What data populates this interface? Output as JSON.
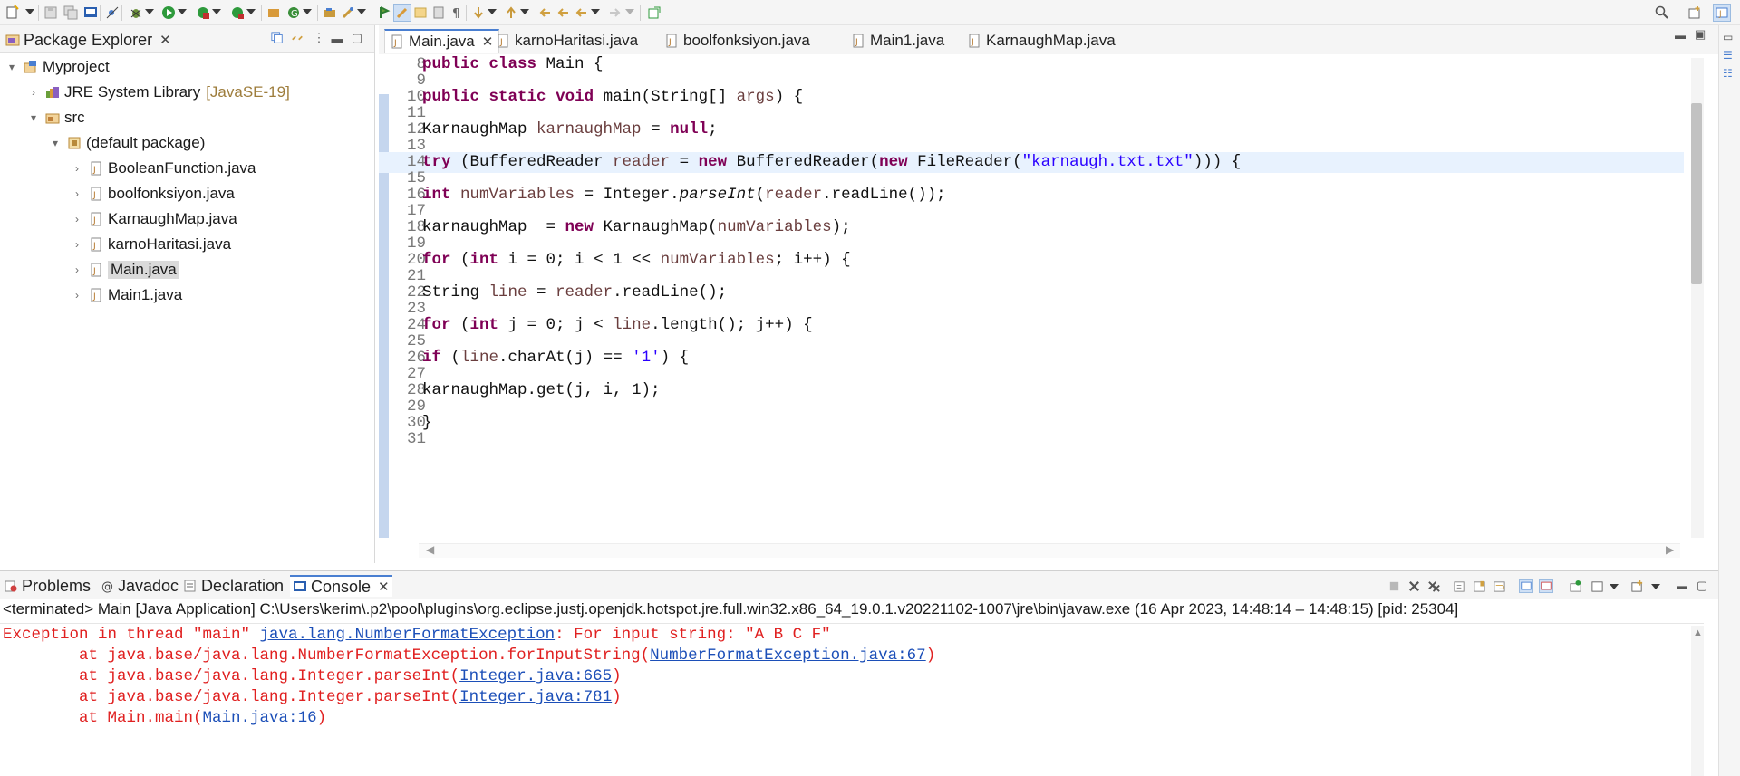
{
  "toolbar": {
    "icons": [
      "new-file-icon",
      "save-icon",
      "save-all-icon",
      "terminal-icon",
      "skip-breakpoints-icon",
      "debug-icon",
      "run-icon",
      "coverage-icon",
      "external-tools-icon",
      "new-java-project-icon",
      "new-package-icon",
      "new-class-icon",
      "open-type-icon",
      "search-icon",
      "toggle-mark-occurrences-icon",
      "toggle-highlight-icon",
      "block-selection-icon",
      "show-whitespace-icon",
      "next-annotation-icon",
      "previous-annotation-icon",
      "last-edit-location-icon",
      "back-icon",
      "forward-icon",
      "pin-editor-icon",
      "search-icon",
      "open-perspective-icon",
      "java-perspective-icon"
    ]
  },
  "package_explorer": {
    "title": "Package Explorer",
    "tree": [
      {
        "label": "Myproject",
        "icon": "project-icon",
        "twisty": "▾"
      },
      {
        "label": "JRE System Library",
        "decoration": "[JavaSE-19]",
        "icon": "library-icon",
        "twisty": "›"
      },
      {
        "label": "src",
        "icon": "source-folder-icon",
        "twisty": "▾"
      },
      {
        "label": "(default package)",
        "icon": "package-icon",
        "twisty": "▾"
      },
      {
        "label": "BooleanFunction.java",
        "icon": "java-file-icon",
        "twisty": "›"
      },
      {
        "label": "boolfonksiyon.java",
        "icon": "java-file-icon",
        "twisty": "›"
      },
      {
        "label": "KarnaughMap.java",
        "icon": "java-file-icon",
        "twisty": "›"
      },
      {
        "label": "karnoHaritasi.java",
        "icon": "java-file-icon",
        "twisty": "›"
      },
      {
        "label": "Main.java",
        "icon": "java-file-icon",
        "twisty": "›",
        "selected": true
      },
      {
        "label": "Main1.java",
        "icon": "java-file-icon",
        "twisty": "›"
      }
    ]
  },
  "editor": {
    "tabs": [
      {
        "label": "Main.java",
        "active": true
      },
      {
        "label": "karnoHaritasi.java"
      },
      {
        "label": "boolfonksiyon.java"
      },
      {
        "label": "Main1.java"
      },
      {
        "label": "KarnaughMap.java"
      }
    ],
    "lines": [
      {
        "n": "8",
        "text": "public class Main {"
      },
      {
        "n": "9",
        "text": ""
      },
      {
        "n": "10",
        "text": "public static void main(String[] args) {"
      },
      {
        "n": "11",
        "text": ""
      },
      {
        "n": "12",
        "text": "KarnaughMap karnaughMap = null;"
      },
      {
        "n": "13",
        "text": ""
      },
      {
        "n": "14",
        "text": "try (BufferedReader reader = new BufferedReader(new FileReader(\"karnaugh.txt.txt\"))) {"
      },
      {
        "n": "15",
        "text": ""
      },
      {
        "n": "16",
        "text": "int numVariables = Integer.parseInt(reader.readLine());"
      },
      {
        "n": "17",
        "text": ""
      },
      {
        "n": "18",
        "text": "karnaughMap  = new KarnaughMap(numVariables);"
      },
      {
        "n": "19",
        "text": ""
      },
      {
        "n": "20",
        "text": "for (int i = 0; i < 1 << numVariables; i++) {"
      },
      {
        "n": "21",
        "text": ""
      },
      {
        "n": "22",
        "text": "String line = reader.readLine();"
      },
      {
        "n": "23",
        "text": ""
      },
      {
        "n": "24",
        "text": "for (int j = 0; j < line.length(); j++) {"
      },
      {
        "n": "25",
        "text": ""
      },
      {
        "n": "26",
        "text": "if (line.charAt(j) == '1') {"
      },
      {
        "n": "27",
        "text": ""
      },
      {
        "n": "28",
        "text": "karnaughMap.get(j, i, 1);"
      },
      {
        "n": "29",
        "text": ""
      },
      {
        "n": "30",
        "text": "}"
      },
      {
        "n": "31",
        "text": ""
      }
    ]
  },
  "console_panel": {
    "tabs": [
      {
        "label": "Problems",
        "icon": "problems-icon"
      },
      {
        "label": "Javadoc",
        "icon": "javadoc-icon"
      },
      {
        "label": "Declaration",
        "icon": "declaration-icon"
      },
      {
        "label": "Console",
        "icon": "console-icon",
        "active": true
      }
    ],
    "terminated_line": "<terminated> Main [Java Application] C:\\Users\\kerim\\.p2\\pool\\plugins\\org.eclipse.justj.openjdk.hotspot.jre.full.win32.x86_64_19.0.1.v20221102-1007\\jre\\bin\\javaw.exe  (16 Apr 2023, 14:48:14 – 14:48:15) [pid: 25304]",
    "output": [
      {
        "prefix": "Exception in thread \"main\" ",
        "link": "java.lang.NumberFormatException",
        "suffix": ": For input string: \"A B C F\""
      },
      {
        "prefix": "        at java.base/java.lang.NumberFormatException.forInputString(",
        "link": "NumberFormatException.java:67",
        "suffix": ")"
      },
      {
        "prefix": "        at java.base/java.lang.Integer.parseInt(",
        "link": "Integer.java:665",
        "suffix": ")"
      },
      {
        "prefix": "        at java.base/java.lang.Integer.parseInt(",
        "link": "Integer.java:781",
        "suffix": ")"
      },
      {
        "prefix": "        at Main.main(",
        "link": "Main.java:16",
        "suffix": ")"
      }
    ]
  },
  "colors": {
    "keyword": "#7f0055",
    "variable": "#6a3e3e",
    "string": "#2a00ff",
    "error": "#e02020",
    "link": "#1c4fb8",
    "current_line": "#e8f2fe",
    "active_tab_accent": "#4a7fd1"
  }
}
